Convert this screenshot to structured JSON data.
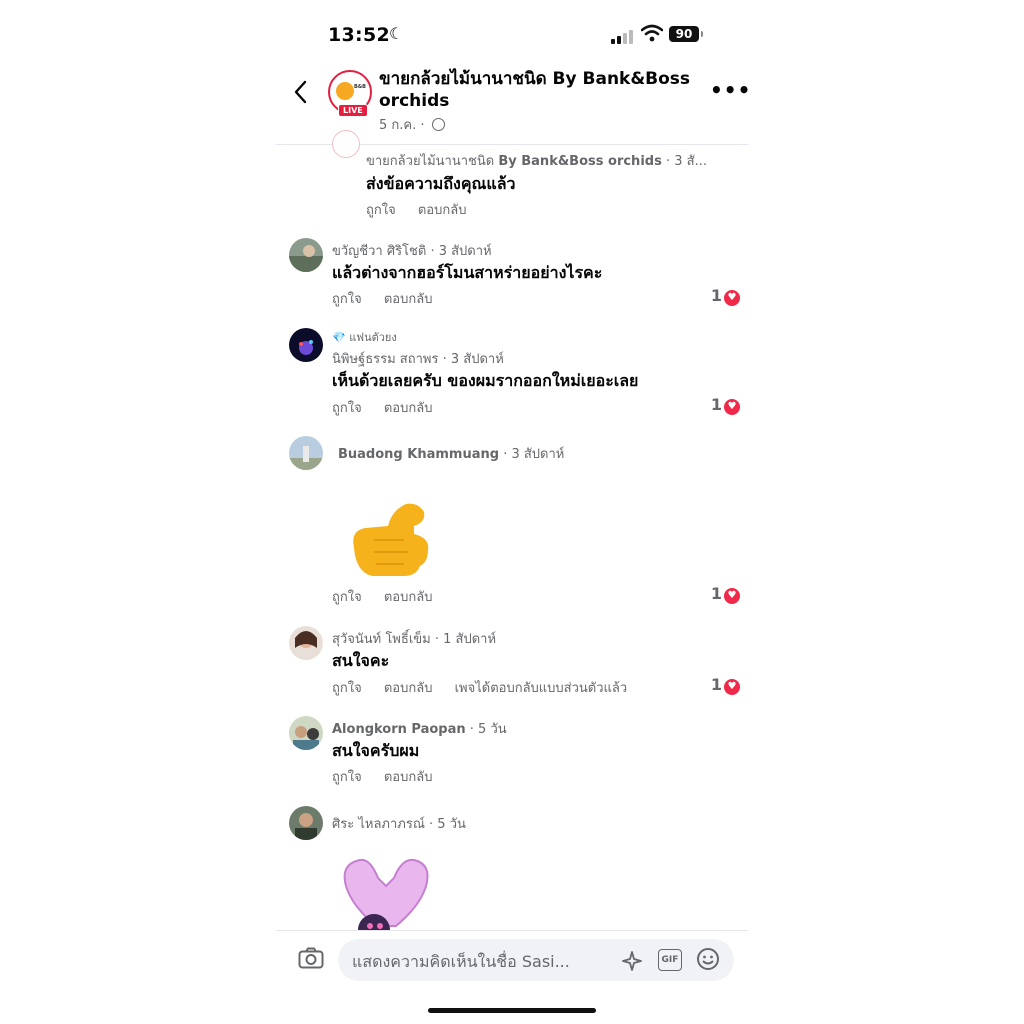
{
  "status_bar": {
    "time": "13:52",
    "battery": "90"
  },
  "header": {
    "title": "ขายกล้วยไม้นานาชนิด By Bank&Boss orchids",
    "live_badge": "LIVE",
    "date": "5 ก.ค. ·"
  },
  "comments": [
    {
      "author": "ขายกล้วยไม้นานาชนิด",
      "author_bold": "By Bank&Boss orchids",
      "time": " · 3 สั...",
      "text": "ส่งข้อความถึงคุณแล้ว",
      "like": "ถูกใจ",
      "reply": "ตอบกลับ"
    },
    {
      "author": "ขวัญชีวา ศิริโชติ",
      "time": " · 3 สัปดาห์",
      "text": "แล้วต่างจากฮอร์โมนสาหร่ายอย่างไรคะ",
      "like": "ถูกใจ",
      "reply": "ตอบกลับ",
      "reactions": "1"
    },
    {
      "badge": "แฟนตัวยง",
      "author": "นิพิษฐ์ธรรม สถาพร",
      "time": " · 3 สัปดาห์",
      "text": "เห็นด้วยเลยครับ ของผมรากออกใหม่เยอะเลย",
      "like": "ถูกใจ",
      "reply": "ตอบกลับ",
      "reactions": "1"
    },
    {
      "author_bold": "Buadong Khammuang",
      "time": " · 3 สัปดาห์",
      "sticker": "thumbs-up",
      "like": "ถูกใจ",
      "reply": "ตอบกลับ",
      "reactions": "1"
    },
    {
      "author": "สุวัจนันท์ โพธิ์เข็ม",
      "time": " · 1 สัปดาห์",
      "text": "สนใจคะ",
      "like": "ถูกใจ",
      "reply": "ตอบกลับ",
      "private_reply": "เพจได้ตอบกลับแบบส่วนตัวแล้ว",
      "reactions": "1"
    },
    {
      "author_bold": "Alongkorn Paopan",
      "time": " · 5 วัน",
      "text": "สนใจครับผม",
      "like": "ถูกใจ",
      "reply": "ตอบกลับ"
    },
    {
      "author": "ศิระ ไหลภาภรณ์",
      "time": " · 5 วัน",
      "sticker": "heart-hands"
    }
  ],
  "composer": {
    "placeholder": "แสดงความคิดเห็นในชื่อ Sasi...",
    "gif_label": "GIF"
  },
  "colors": {
    "accent": "#e41e3f",
    "heart": "#f02849",
    "secondary_text": "#65676b"
  }
}
